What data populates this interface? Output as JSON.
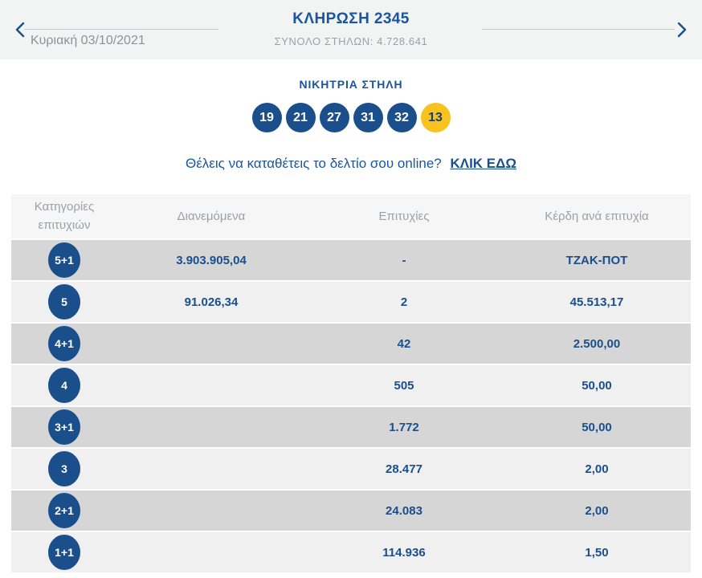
{
  "header": {
    "title": "ΚΛΗΡΩΣΗ 2345",
    "total_columns": "ΣΥΝΟΛΟ ΣΤΗΛΩΝ: 4.728.641",
    "date": "Κυριακή 03/10/2021"
  },
  "winning": {
    "label": "ΝΙΚΗΤΡΙΑ ΣΤΗΛΗ",
    "numbers": [
      "19",
      "21",
      "27",
      "31",
      "32"
    ],
    "bonus": "13"
  },
  "cta": {
    "text": "Θέλεις να καταθέτεις το δελτίο σου online?",
    "link_label": "ΚΛΙΚ ΕΔΩ"
  },
  "table": {
    "headers": [
      "Κατηγορίες επιτυχιών",
      "Διανεμόμενα",
      "Επιτυχίες",
      "Κέρδη ανά επιτυχία"
    ],
    "rows": [
      {
        "category": "5+1",
        "distributed": "3.903.905,04",
        "winners": "-",
        "prize": "ΤΖΑΚ-ΠΟΤ"
      },
      {
        "category": "5",
        "distributed": "91.026,34",
        "winners": "2",
        "prize": "45.513,17"
      },
      {
        "category": "4+1",
        "distributed": "",
        "winners": "42",
        "prize": "2.500,00"
      },
      {
        "category": "4",
        "distributed": "",
        "winners": "505",
        "prize": "50,00"
      },
      {
        "category": "3+1",
        "distributed": "",
        "winners": "1.772",
        "prize": "50,00"
      },
      {
        "category": "3",
        "distributed": "",
        "winners": "28.477",
        "prize": "2,00"
      },
      {
        "category": "2+1",
        "distributed": "",
        "winners": "24.083",
        "prize": "2,00"
      },
      {
        "category": "1+1",
        "distributed": "",
        "winners": "114.936",
        "prize": "1,50"
      }
    ]
  },
  "colors": {
    "brand_blue": "#1a4f8c",
    "bonus_yellow": "#f9c31f"
  }
}
